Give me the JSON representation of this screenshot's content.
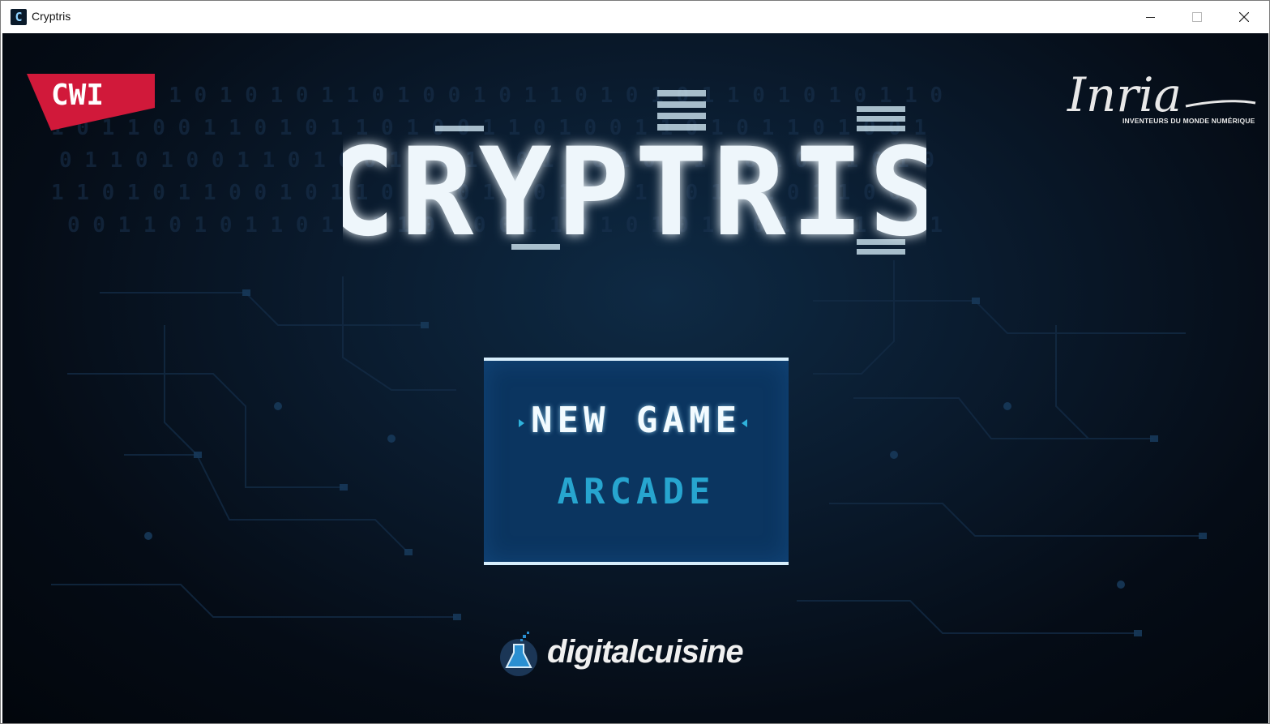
{
  "window": {
    "title": "Cryptris",
    "icon": "cryptris-app-icon",
    "controls": {
      "minimize": "minimize-icon",
      "maximize": "maximize-icon",
      "close": "close-icon"
    }
  },
  "game": {
    "partner_left": "CWI",
    "partner_right": {
      "name": "Inria",
      "tagline": "INVENTEURS DU MONDE NUMÉRIQUE"
    },
    "logo_title": "CRYPTRIS",
    "menu": {
      "items": [
        {
          "label": "NEW GAME",
          "selected": true
        },
        {
          "label": "ARCADE",
          "selected": false
        }
      ]
    },
    "footer_brand": "digitalcuisine"
  },
  "colors": {
    "background": "#050c16",
    "menu_panel": "#0b3560",
    "menu_border": "#d7eefc",
    "menu_selected": "#f2fbff",
    "menu_unselected": "#27a5cf",
    "cwi_red": "#d1193a"
  }
}
